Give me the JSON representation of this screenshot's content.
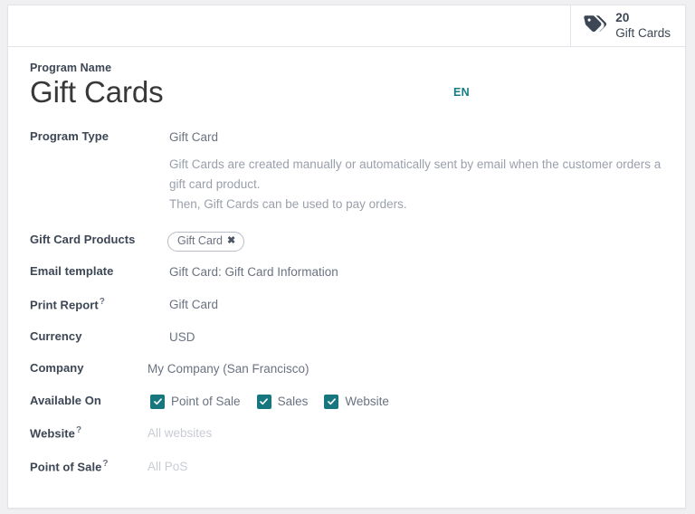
{
  "stat_button": {
    "icon": "tag-icon",
    "value": "20",
    "label": "Gift Cards"
  },
  "header": {
    "name_label": "Program Name",
    "name_value": "Gift Cards",
    "language_badge": "EN"
  },
  "fields": {
    "program_type": {
      "label": "Program Type",
      "value": "Gift Card",
      "description_line1": "Gift Cards are created manually or automatically sent by email when the customer orders a gift card product.",
      "description_line2": "Then, Gift Cards can be used to pay orders."
    },
    "gift_card_products": {
      "label": "Gift Card Products",
      "tag": "Gift Card",
      "remove_icon": "close-icon"
    },
    "email_template": {
      "label": "Email template",
      "value": "Gift Card: Gift Card Information"
    },
    "print_report": {
      "label": "Print Report",
      "help": "?",
      "value": "Gift Card"
    },
    "currency": {
      "label": "Currency",
      "value": "USD"
    },
    "company": {
      "label": "Company",
      "value": "My Company (San Francisco)"
    },
    "available_on": {
      "label": "Available On",
      "options": [
        {
          "label": "Point of Sale",
          "checked": true
        },
        {
          "label": "Sales",
          "checked": true
        },
        {
          "label": "Website",
          "checked": true
        }
      ]
    },
    "website": {
      "label": "Website",
      "help": "?",
      "placeholder": "All websites"
    },
    "point_of_sale": {
      "label": "Point of Sale",
      "help": "?",
      "placeholder": "All PoS"
    }
  },
  "colors": {
    "accent_teal": "#17777f",
    "label_dark": "#3c4654",
    "value_gray": "#6b7280",
    "placeholder_gray": "#c9ccd4",
    "border": "#e2e3e8",
    "page_bg": "#f0f0f3"
  }
}
